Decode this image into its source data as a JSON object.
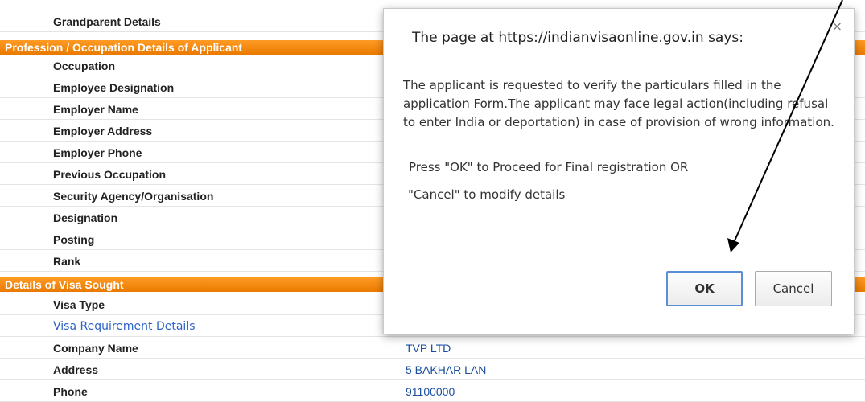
{
  "form": {
    "top_row": "Grandparent Details",
    "sections": [
      {
        "title": "Profession / Occupation Details of Applicant",
        "rows": [
          "Occupation",
          "Employee Designation",
          "Employer Name",
          "Employer Address",
          "Employer Phone",
          "Previous Occupation",
          "Security Agency/Organisation",
          "Designation",
          "Posting",
          "Rank"
        ]
      },
      {
        "title": "Details of Visa Sought",
        "rows": [
          {
            "label": "Visa Type",
            "value": ""
          },
          {
            "label": "Visa Requirement Details",
            "value": "",
            "link": true
          },
          {
            "label": "Company Name",
            "value": "TVP LTD"
          },
          {
            "label": "Address",
            "value": "5 BAKHAR LAN"
          },
          {
            "label": "Phone",
            "value": "91100000"
          }
        ]
      }
    ]
  },
  "dialog": {
    "title": "The page at https://indianvisaonline.gov.in says:",
    "close_glyph": "×",
    "message": "The applicant is requested to verify the particulars filled in the application Form.The applicant may face legal action(including refusal to enter India or deportation) in case of provision of wrong information.",
    "line1": "Press \"OK\" to Proceed for Final registration  OR",
    "line2": "\"Cancel\" to modify details",
    "ok_label": "OK",
    "cancel_label": "Cancel"
  },
  "colors": {
    "section_bar": "#ea7a00",
    "link": "#2b63c8",
    "value_text": "#1a4fa0",
    "ok_border": "#5a8fd8"
  }
}
